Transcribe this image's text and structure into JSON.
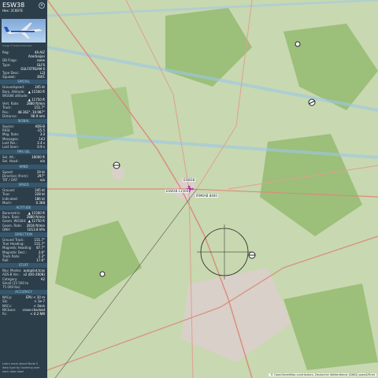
{
  "aircraft": {
    "callsign": "ESW38",
    "hex_line": "Hex: 3C6B7E",
    "photo_credit": "Image © Robert Morrison"
  },
  "details": [
    {
      "label": "Reg:",
      "value": "4X-AIZ"
    },
    {
      "label": "",
      "value": "Azerbaijan"
    },
    {
      "label": "DB Flags:",
      "value": "none"
    },
    {
      "label": "Type:",
      "value": "GLF6"
    },
    {
      "label": "",
      "value": "GULFSTREAM 6"
    },
    {
      "label": "Type Desc:",
      "value": "L2J"
    },
    {
      "label": "Squawk:",
      "value": "3601"
    }
  ],
  "sections": {
    "spatial": "SPATIAL",
    "signal": "SIGNAL",
    "fms": "FMS SEL",
    "wind": "WIND",
    "speed": "SPEED",
    "altitude": "ALTITUDE",
    "direction": "DIRECTION",
    "stuff": "STUFF",
    "accuracy": "ACCURACY"
  },
  "spatial": [
    {
      "label": "Groundspeed:",
      "value": "245 kt"
    },
    {
      "label": "Baro. Altitude:",
      "value": "▲ 11500 ft"
    },
    {
      "label": "WGS84 altitude:",
      "value": ""
    },
    {
      "label": "",
      "value": "▲ 11750 ft"
    },
    {
      "label": "Vert. Rate:",
      "value": "2880 ft/min"
    },
    {
      "label": "Track:",
      "value": "151.7°"
    },
    {
      "label": "Pos.:",
      "value": "48.362°, 10.987°"
    },
    {
      "label": "Distance:",
      "value": "96.9 nmi"
    }
  ],
  "signal": [
    {
      "label": "Source:",
      "value": "ADS-B"
    },
    {
      "label": "RSSI:",
      "value": "-25.5"
    },
    {
      "label": "Msg. Rate:",
      "value": "3.0"
    },
    {
      "label": "Messages:",
      "value": "143"
    },
    {
      "label": "Last Pos.:",
      "value": "2.4 s"
    },
    {
      "label": "Last Seen:",
      "value": "0.9 s"
    }
  ],
  "fms": [
    {
      "label": "Sel. Alt.:",
      "value": "16000 ft"
    },
    {
      "label": "Sel. Head.:",
      "value": "n/a"
    }
  ],
  "wind": [
    {
      "label": "Speed:",
      "value": "19 kt"
    },
    {
      "label": "Direction (from):",
      "value": "297°"
    },
    {
      "label": "TAT / OAT:",
      "value": "n/a"
    }
  ],
  "speed": [
    {
      "label": "Ground:",
      "value": "245 kt"
    },
    {
      "label": "True:",
      "value": "228 kt"
    },
    {
      "label": "Indicated:",
      "value": "186 kt"
    },
    {
      "label": "Mach:",
      "value": "0.368"
    }
  ],
  "altitude": [
    {
      "label": "Barometric:",
      "value": "▲ 11500 ft"
    },
    {
      "label": "Baro. Rate:",
      "value": "2880 ft/min"
    },
    {
      "label": "Geom. WGS84:",
      "value": "▲ 11750 ft"
    },
    {
      "label": "Geom. Rate:",
      "value": "2816 ft/min"
    },
    {
      "label": "QNH:",
      "value": "1013.8 hPa"
    }
  ],
  "direction": [
    {
      "label": "Ground Track:",
      "value": "151.7°"
    },
    {
      "label": "True Heading:",
      "value": "151.7°"
    },
    {
      "label": "Magnetic Heading:",
      "value": "87.7°"
    },
    {
      "label": "Magnetic Decl.:",
      "value": "3.6°"
    },
    {
      "label": "Track Rate:",
      "value": "2.3°"
    },
    {
      "label": "Roll:",
      "value": "17.6°"
    }
  ],
  "stuff": [
    {
      "label": "Nav. Modes:",
      "value": "autopilot,tcas"
    },
    {
      "label": "ADS-B Ver.:",
      "value": "v2 (DO-260B)"
    },
    {
      "label": "Category:",
      "value": "A2"
    },
    {
      "label": "Small (15 500 to",
      "value": ""
    },
    {
      "label": "75 000 lbs)",
      "value": ""
    }
  ],
  "accuracy": [
    {
      "label": "NACp:",
      "value": "EPU < 10 m"
    },
    {
      "label": "SIL:",
      "value": "< 1e-7"
    },
    {
      "label": "NACv:",
      "value": "< 3m/s"
    },
    {
      "label": "NICbaro:",
      "value": "cross-checked"
    },
    {
      "label": "Rc:",
      "value": "< 0.2 NM"
    }
  ],
  "footer": "Learn more about Mode S data type by hovering over each data label",
  "map": {
    "attribution": "© OpenStreetMap contributors, Deutscher Wetterdienst (DWD) openAIP.net",
    "aircraft_label_1": "ESW38",
    "aircraft_label_2": "ESW38 11500",
    "aircraft_label_3": "IRM6AB 8400",
    "colors": {
      "land": "#c8d8b0",
      "forest": "#9cbf7a",
      "urban": "#d9d0c9",
      "road": "#d98c7a",
      "airway": "#9cc8e8"
    }
  }
}
